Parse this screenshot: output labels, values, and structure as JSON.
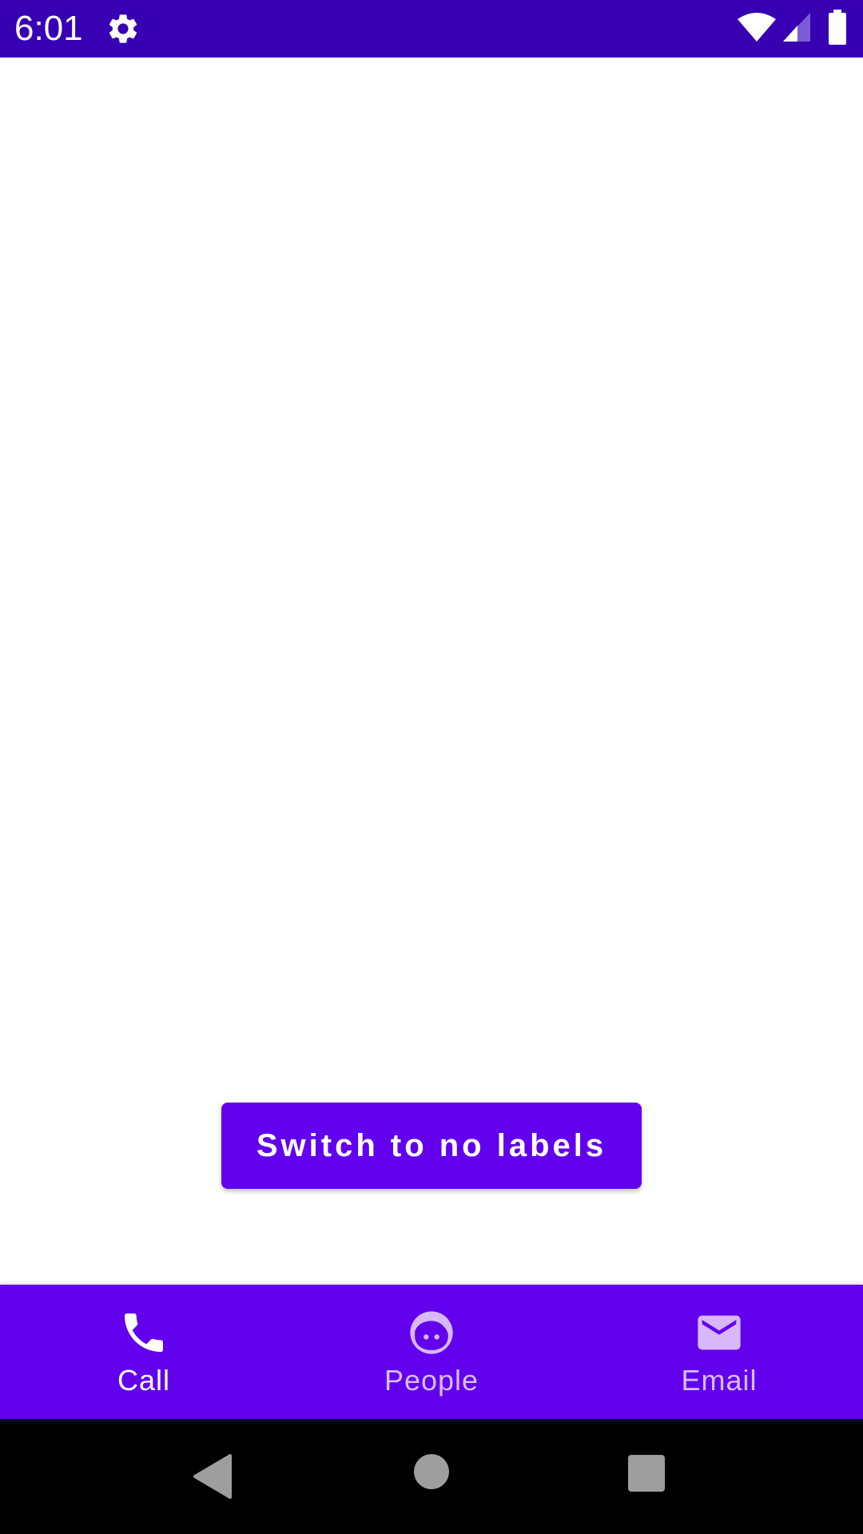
{
  "status_bar": {
    "time": "6:01",
    "icons": [
      "gear-icon",
      "wifi-icon",
      "cell-signal-icon",
      "battery-icon"
    ],
    "background": "#3700b3"
  },
  "main": {
    "switch_button_label": "Switch to no labels",
    "button_color": "#6200ee"
  },
  "bottom_nav": {
    "background": "#6200ee",
    "items": [
      {
        "label": "Call",
        "icon": "phone-icon",
        "selected": true
      },
      {
        "label": "People",
        "icon": "face-icon",
        "selected": false
      },
      {
        "label": "Email",
        "icon": "email-icon",
        "selected": false
      }
    ]
  },
  "system_nav": {
    "icons": [
      "back-icon",
      "home-icon",
      "recents-icon"
    ]
  }
}
